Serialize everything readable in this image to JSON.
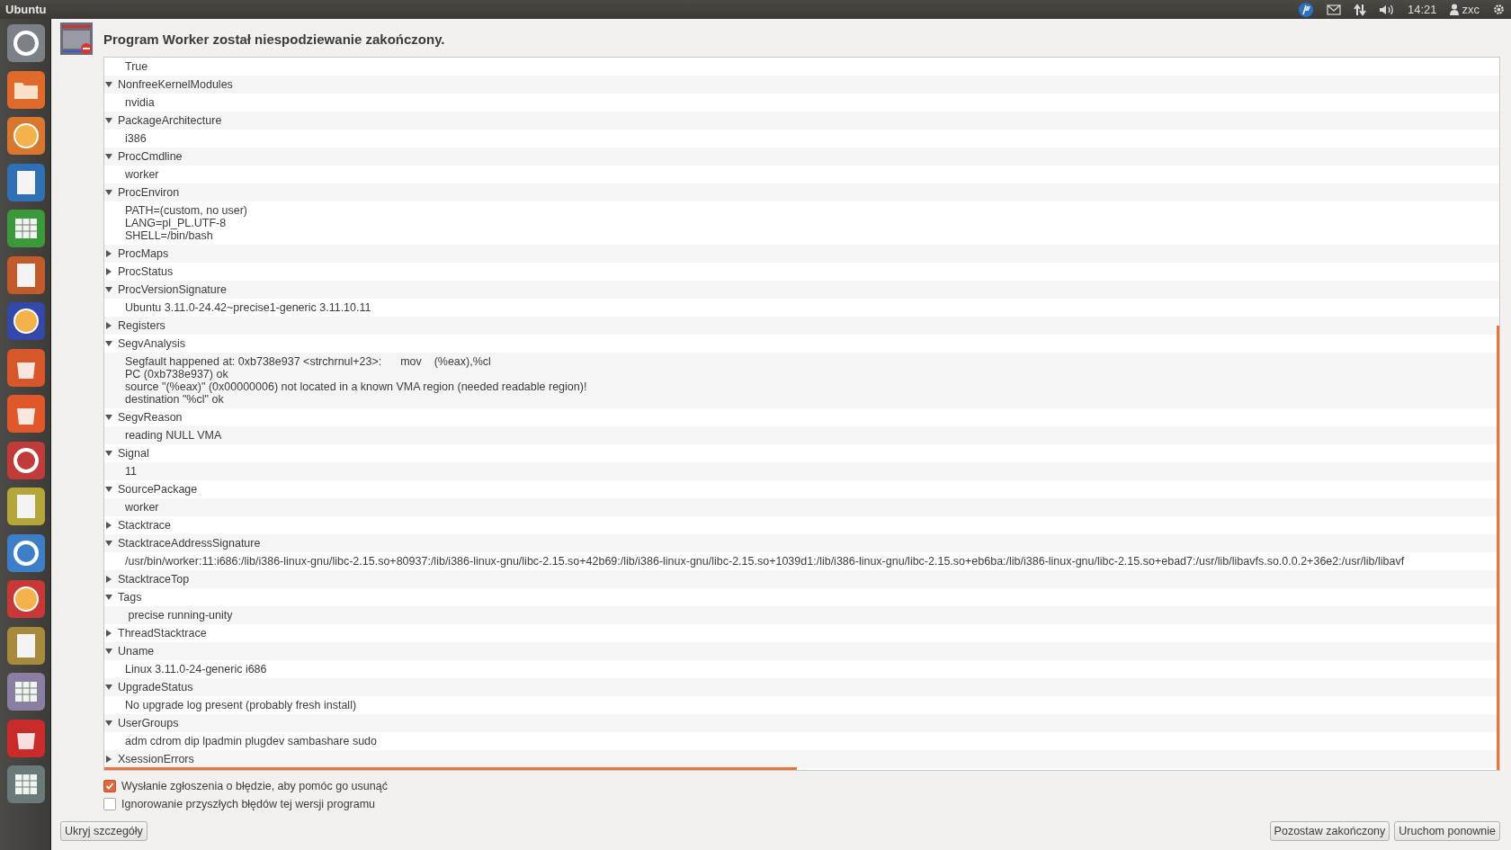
{
  "top_bar": {
    "title": "Ubuntu",
    "clock": "14:21",
    "user": "zxc"
  },
  "dialog": {
    "title": "Program Worker został niespodziewanie zakończony.",
    "partial_value": "True",
    "fields": [
      {
        "name": "NonfreeKernelModules",
        "expanded": true,
        "lines": [
          "nvidia"
        ]
      },
      {
        "name": "PackageArchitecture",
        "expanded": true,
        "lines": [
          "i386"
        ]
      },
      {
        "name": "ProcCmdline",
        "expanded": true,
        "lines": [
          "worker"
        ]
      },
      {
        "name": "ProcEnviron",
        "expanded": true,
        "lines": [
          "PATH=(custom, no user)",
          "LANG=pl_PL.UTF-8",
          "SHELL=/bin/bash"
        ]
      },
      {
        "name": "ProcMaps",
        "expanded": false
      },
      {
        "name": "ProcStatus",
        "expanded": false
      },
      {
        "name": "ProcVersionSignature",
        "expanded": true,
        "lines": [
          "Ubuntu 3.11.0-24.42~precise1-generic 3.11.10.11"
        ]
      },
      {
        "name": "Registers",
        "expanded": false
      },
      {
        "name": "SegvAnalysis",
        "expanded": true,
        "lines": [
          "Segfault happened at: 0xb738e937 <strchrnul+23>:      mov    (%eax),%cl",
          "PC (0xb738e937) ok",
          "source \"(%eax)\" (0x00000006) not located in a known VMA region (needed readable region)!",
          "destination \"%cl\" ok"
        ]
      },
      {
        "name": "SegvReason",
        "expanded": true,
        "lines": [
          "reading NULL VMA"
        ]
      },
      {
        "name": "Signal",
        "expanded": true,
        "lines": [
          "11"
        ]
      },
      {
        "name": "SourcePackage",
        "expanded": true,
        "lines": [
          "worker"
        ]
      },
      {
        "name": "Stacktrace",
        "expanded": false
      },
      {
        "name": "StacktraceAddressSignature",
        "expanded": true,
        "lines": [
          "/usr/bin/worker:11:i686:/lib/i386-linux-gnu/libc-2.15.so+80937:/lib/i386-linux-gnu/libc-2.15.so+42b69:/lib/i386-linux-gnu/libc-2.15.so+1039d1:/lib/i386-linux-gnu/libc-2.15.so+eb6ba:/lib/i386-linux-gnu/libc-2.15.so+ebad7:/usr/lib/libavfs.so.0.0.2+36e2:/usr/lib/libavf"
        ]
      },
      {
        "name": "StacktraceTop",
        "expanded": false
      },
      {
        "name": "Tags",
        "expanded": true,
        "lines": [
          " precise running-unity"
        ]
      },
      {
        "name": "ThreadStacktrace",
        "expanded": false
      },
      {
        "name": "Uname",
        "expanded": true,
        "lines": [
          "Linux 3.11.0-24-generic i686"
        ]
      },
      {
        "name": "UpgradeStatus",
        "expanded": true,
        "lines": [
          "No upgrade log present (probably fresh install)"
        ]
      },
      {
        "name": "UserGroups",
        "expanded": true,
        "lines": [
          "adm cdrom dip lpadmin plugdev sambashare sudo"
        ]
      },
      {
        "name": "XsessionErrors",
        "expanded": false
      }
    ],
    "options": [
      {
        "label": "Wysłanie zgłoszenia o błędzie, aby pomóc go usunąć",
        "checked": true
      },
      {
        "label": "Ignorowanie przyszłych błędów tej wersji programu",
        "checked": false
      }
    ],
    "left_buttons": [
      "Ukryj szczegóły"
    ],
    "right_buttons": [
      "Pozostaw zakończony",
      "Uruchom ponownie"
    ]
  }
}
